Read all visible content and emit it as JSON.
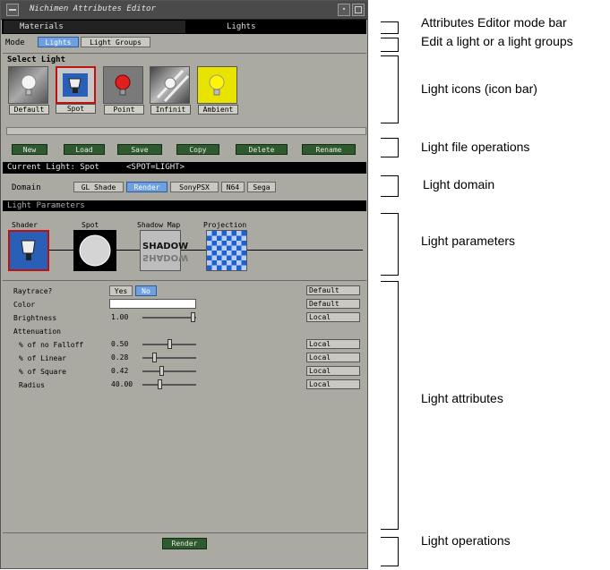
{
  "window": {
    "title": "Nichimen Attributes Editor"
  },
  "mode_tabs": [
    "Materials",
    "Lights"
  ],
  "mode": {
    "label": "Mode",
    "options": [
      "Lights",
      "Light Groups"
    ],
    "selected": "Lights"
  },
  "select_light": {
    "heading": "Select Light",
    "icons": [
      {
        "label": "Default",
        "icon": "lightbulb-white-icon"
      },
      {
        "label": "Spot",
        "icon": "spotlight-icon"
      },
      {
        "label": "Point",
        "icon": "lightbulb-red-icon"
      },
      {
        "label": "Infinit",
        "icon": "infinite-light-icon"
      },
      {
        "label": "Ambient",
        "icon": "lightbulb-yellow-icon"
      }
    ]
  },
  "file_ops": [
    "New",
    "Load",
    "Save",
    "Copy",
    "Delete",
    "Rename"
  ],
  "current_light": {
    "label": "Current Light: Spot",
    "tag": "<SPOT=LIGHT>"
  },
  "domain": {
    "label": "Domain",
    "options": [
      "GL Shade",
      "Render",
      "SonyPSX",
      "N64",
      "Sega"
    ],
    "selected": "Render"
  },
  "light_parameters": {
    "heading": "Light Parameters",
    "items": [
      "Shader",
      "Spot",
      "Shadow Map",
      "Projection"
    ],
    "shadow_text": "SHADOW"
  },
  "attributes": {
    "raytrace": {
      "label": "Raytrace?",
      "options": [
        "Yes",
        "No"
      ],
      "selected": "No",
      "source": "Default"
    },
    "color": {
      "label": "Color",
      "source": "Default"
    },
    "brightness": {
      "label": "Brightness",
      "value": "1.00",
      "source": "Local"
    },
    "attenuation_heading": "Attenuation",
    "rows": [
      {
        "label": "% of no Falloff",
        "value": "0.50",
        "source": "Local",
        "level": 0.5
      },
      {
        "label": "% of Linear",
        "value": "0.28",
        "source": "Local",
        "level": 0.2
      },
      {
        "label": "% of Square",
        "value": "0.42",
        "source": "Local",
        "level": 0.35
      },
      {
        "label": "Radius",
        "value": "40.00",
        "source": "Local",
        "level": 0.3
      }
    ]
  },
  "render_button": "Render",
  "annotations": [
    "Attributes Editor mode bar",
    "Edit a light or a light groups",
    "Light icons (icon bar)",
    "Light file operations",
    "Light domain",
    "Light parameters",
    "Light attributes",
    "Light operations"
  ],
  "colors": {
    "window_bg": "#aaa9a2",
    "selected_blue": "#6ea0e0",
    "button_green": "#2f5a2f",
    "spot_border_red": "#c01010"
  }
}
